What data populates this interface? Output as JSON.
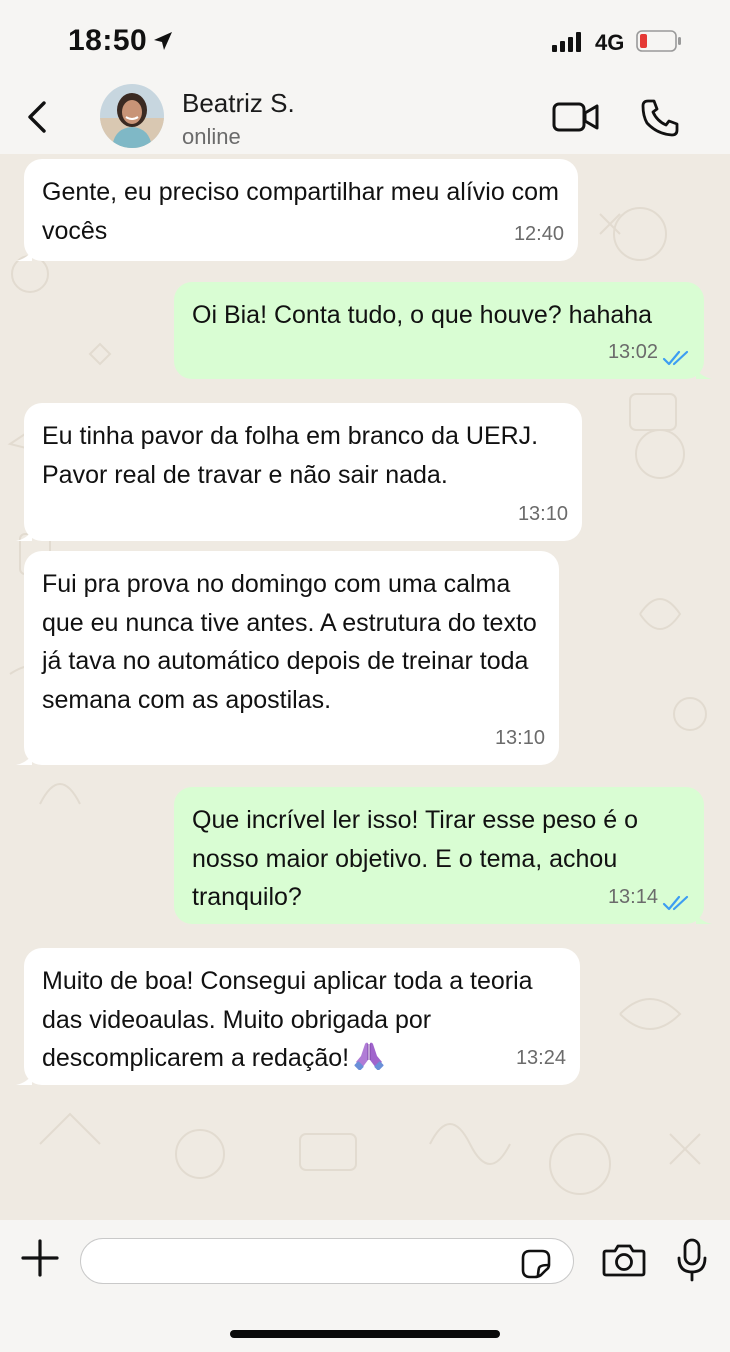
{
  "status_bar": {
    "time": "18:50",
    "network": "4G",
    "icons": [
      "location-arrow-icon",
      "signal-icon",
      "battery-low-icon"
    ],
    "battery_color": "#e53935"
  },
  "header": {
    "contact_name": "Beatriz S.",
    "contact_status": "online",
    "icons": [
      "back-chevron-icon",
      "avatar",
      "video-call-icon",
      "phone-call-icon"
    ]
  },
  "messages": [
    {
      "direction": "in",
      "text": "Gente, eu preciso compartilhar meu alívio com vocês",
      "time": "12:40"
    },
    {
      "direction": "out",
      "text": "Oi Bia! Conta tudo, o que houve? hahaha",
      "time": "13:02",
      "read": true
    },
    {
      "direction": "in",
      "text": "Eu tinha pavor da folha em branco da UERJ. Pavor real de travar e não sair nada.",
      "time": "13:10"
    },
    {
      "direction": "in",
      "text": "Fui pra prova no domingo com uma calma que eu nunca tive antes. A estrutura do texto já tava no automático depois de treinar toda semana com as apostilas.",
      "time": "13:10"
    },
    {
      "direction": "out",
      "text": "Que incrível ler isso! Tirar esse peso é o nosso maior objetivo. E o tema, achou tranquilo?",
      "time": "13:14",
      "read": true
    },
    {
      "direction": "in",
      "text": "Muito de boa! Consegui aplicar toda a teoria das videoaulas. Muito obrigada por descomplicarem a redação!",
      "time": "13:24",
      "emoji": "folded-hands-icon"
    }
  ],
  "input_bar": {
    "placeholder": "",
    "icons": [
      "plus-icon",
      "sticker-icon",
      "camera-icon",
      "microphone-icon"
    ]
  },
  "colors": {
    "incoming_bubble": "#ffffff",
    "outgoing_bubble": "#d9fdd3",
    "read_ticks": "#3d9df2",
    "wallpaper": "#efeae2",
    "bars": "#f6f5f3"
  }
}
